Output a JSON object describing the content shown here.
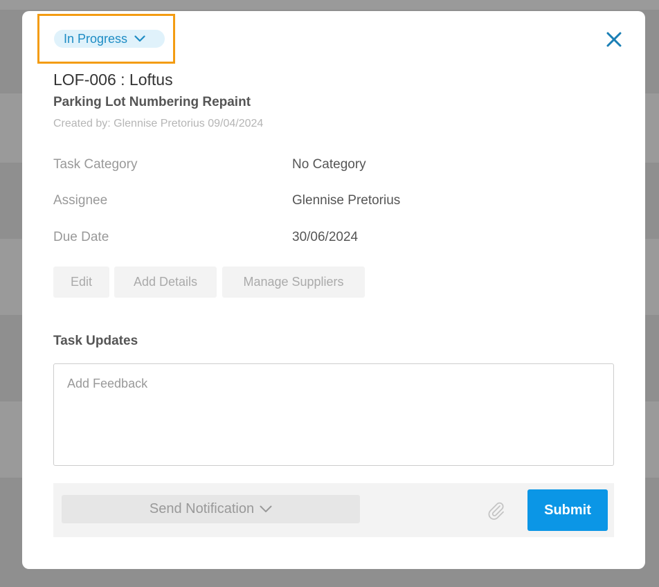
{
  "status": {
    "label": "In Progress"
  },
  "task": {
    "id_line": "LOF-006 : Loftus",
    "title": "Parking Lot Numbering Repaint",
    "created_by": "Created by: Glennise Pretorius 09/04/2024"
  },
  "fields": [
    {
      "label": "Task Category",
      "value": "No Category"
    },
    {
      "label": "Assignee",
      "value": "Glennise Pretorius"
    },
    {
      "label": "Due Date",
      "value": "30/06/2024"
    }
  ],
  "actions": {
    "edit": "Edit",
    "add_details": "Add Details",
    "manage_suppliers": "Manage Suppliers"
  },
  "updates": {
    "title": "Task Updates",
    "feedback_placeholder": "Add Feedback",
    "feedback_value": ""
  },
  "footer": {
    "send_notification": "Send Notification",
    "submit": "Submit"
  },
  "icons": {
    "close": "close-icon",
    "status_chevron": "chevron-down-icon",
    "notification_chevron": "chevron-down-icon",
    "attach": "paperclip-icon"
  },
  "colors": {
    "accent": "#0b96e6",
    "status_text": "#1d8cc4",
    "status_bg": "#e0f2fb",
    "highlight": "#f39c12",
    "close": "#1a7fb5"
  }
}
